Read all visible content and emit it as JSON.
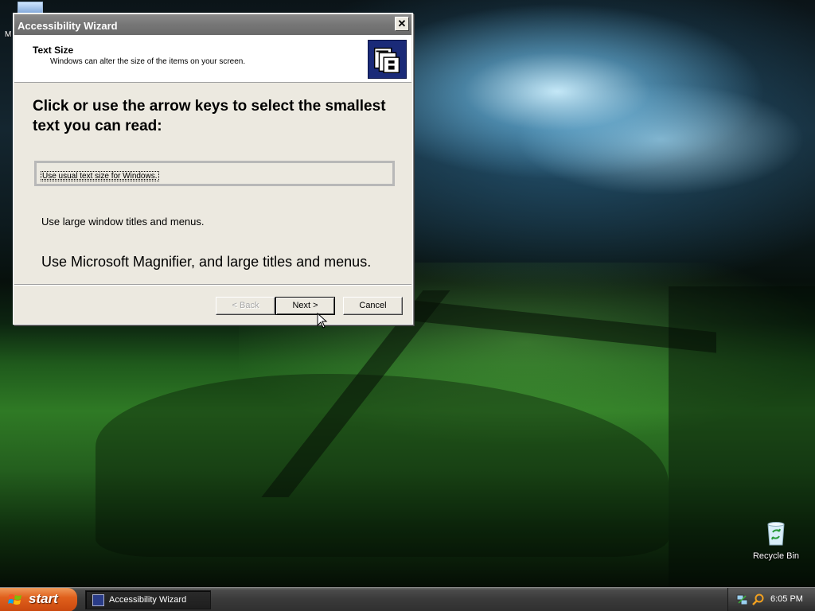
{
  "desktop": {
    "partial_icon_label": "M",
    "recycle_bin_label": "Recycle Bin"
  },
  "dialog": {
    "title": "Accessibility Wizard",
    "close_label": "✕",
    "header_title": "Text Size",
    "header_subtitle": "Windows can alter the size of the items on your screen.",
    "header_icon": "accessibility-wizard-icon",
    "instruction": "Click or use the arrow keys to select the smallest text you can read:",
    "options": [
      {
        "label": "Use usual text size for Windows.",
        "selected": true
      },
      {
        "label": "Use large window titles and menus.",
        "selected": false
      },
      {
        "label": "Use Microsoft Magnifier, and large titles and menus.",
        "selected": false
      }
    ],
    "buttons": {
      "back": "< Back",
      "next": "Next >",
      "cancel": "Cancel"
    }
  },
  "taskbar": {
    "start_label": "start",
    "task_item_label": "Accessibility Wizard",
    "clock": "6:05 PM",
    "accent_color": "#e0601c"
  }
}
